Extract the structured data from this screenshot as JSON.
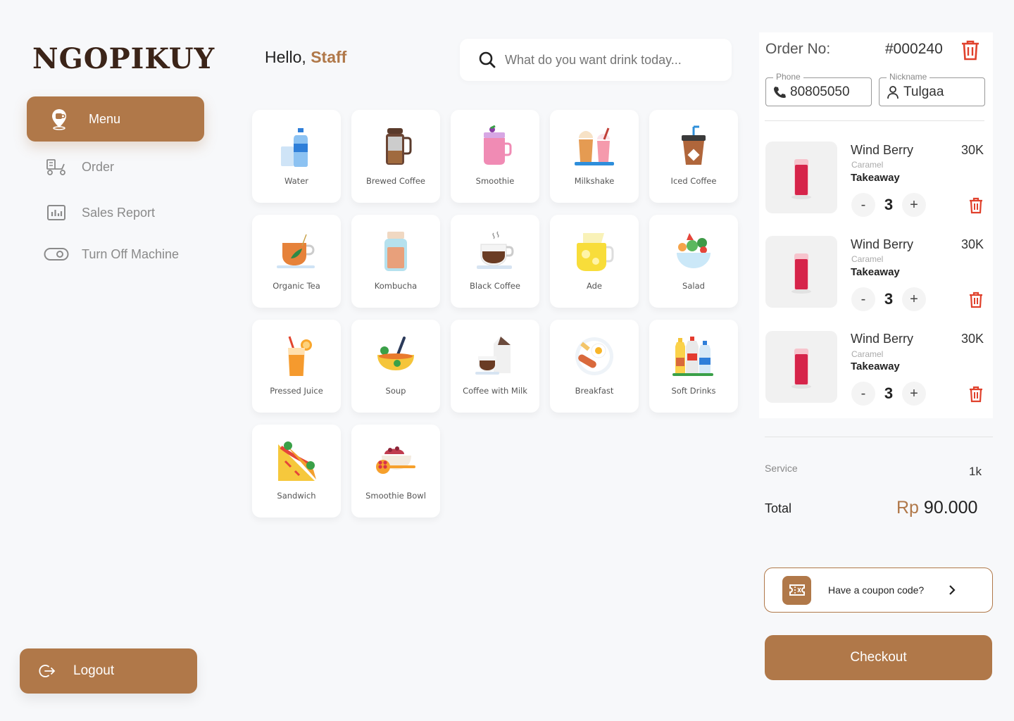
{
  "brand": {
    "name": "NGOPIKUY"
  },
  "sidebar": {
    "items": [
      {
        "label": "Menu",
        "icon": "coffee-location-icon",
        "active": true
      },
      {
        "label": "Order",
        "icon": "delivery-scooter-icon",
        "active": false
      },
      {
        "label": "Sales Report",
        "icon": "bar-chart-icon",
        "active": false
      },
      {
        "label": "Turn Off Machine",
        "icon": "toggle-icon",
        "active": false
      }
    ],
    "logout_label": "Logout"
  },
  "header": {
    "greeting": "Hello,",
    "user": "Staff",
    "search_placeholder": "What do you want drink today..."
  },
  "menu": {
    "items": [
      {
        "label": "Water",
        "icon": "water-bottle-icon"
      },
      {
        "label": "Brewed Coffee",
        "icon": "french-press-icon"
      },
      {
        "label": "Smoothie",
        "icon": "smoothie-jar-icon"
      },
      {
        "label": "Milkshake",
        "icon": "milkshake-icon"
      },
      {
        "label": "Iced Coffee",
        "icon": "iced-coffee-icon"
      },
      {
        "label": "Organic Tea",
        "icon": "tea-cup-icon"
      },
      {
        "label": "Kombucha",
        "icon": "kombucha-jar-icon"
      },
      {
        "label": "Black Coffee",
        "icon": "black-coffee-icon"
      },
      {
        "label": "Ade",
        "icon": "lemonade-pitcher-icon"
      },
      {
        "label": "Salad",
        "icon": "salad-bowl-icon"
      },
      {
        "label": "Pressed Juice",
        "icon": "juice-glass-icon"
      },
      {
        "label": "Soup",
        "icon": "soup-bowl-icon"
      },
      {
        "label": "Coffee with Milk",
        "icon": "coffee-milk-icon"
      },
      {
        "label": "Breakfast",
        "icon": "breakfast-plate-icon"
      },
      {
        "label": "Soft Drinks",
        "icon": "soft-drinks-icon"
      },
      {
        "label": "Sandwich",
        "icon": "sandwich-icon"
      },
      {
        "label": "Smoothie Bowl",
        "icon": "smoothie-bowl-icon"
      }
    ]
  },
  "order": {
    "label": "Order No:",
    "number": "#000240",
    "phone_label": "Phone",
    "phone": "80805050",
    "nickname_label": "Nickname",
    "nickname": "Tulgaa",
    "items": [
      {
        "name": "Wind Berry",
        "price": "30K",
        "variant": "Caramel",
        "type": "Takeaway",
        "qty": "3"
      },
      {
        "name": "Wind Berry",
        "price": "30K",
        "variant": "Caramel",
        "type": "Takeaway",
        "qty": "3"
      },
      {
        "name": "Wind Berry",
        "price": "30K",
        "variant": "Caramel",
        "type": "Takeaway",
        "qty": "3"
      }
    ],
    "minus": "-",
    "plus": "+",
    "service_label": "Service",
    "service_value": "1k",
    "total_label": "Total",
    "currency": "Rp",
    "total_value": "90.000",
    "coupon_label": "Have a coupon code?",
    "checkout_label": "Checkout"
  },
  "colors": {
    "accent": "#b07849",
    "delete": "#e0412c",
    "logo": "#3b2418"
  }
}
